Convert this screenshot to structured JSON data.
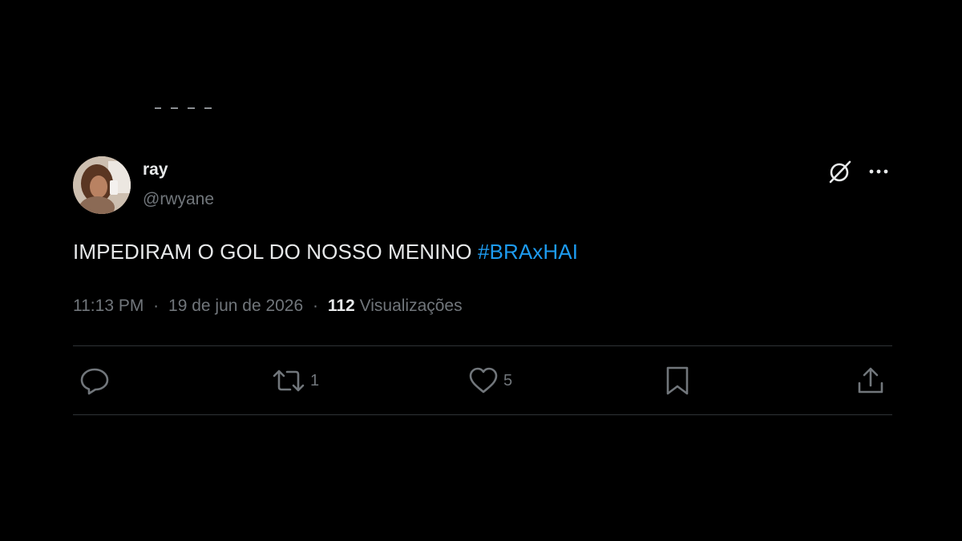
{
  "tweet": {
    "display_name": "ray",
    "handle": "@rwyane",
    "text_main": "IMPEDIRAM O GOL DO NOSSO MENINO ",
    "hashtag": "#BRAxHAI",
    "time": "11:13 PM",
    "separator": "·",
    "date": "19 de jun de 2026",
    "views_count": "112",
    "views_label": "Visualizações"
  },
  "actions": {
    "reply_count": "",
    "retweet_count": "1",
    "like_count": "5"
  },
  "icons": {
    "grok": "grok-icon",
    "more": "more-icon",
    "reply": "reply-icon",
    "retweet": "retweet-icon",
    "like": "heart-icon",
    "bookmark": "bookmark-icon",
    "share": "share-icon"
  },
  "colors": {
    "background": "#000000",
    "text": "#e7e9ea",
    "muted": "#71767b",
    "accent": "#1d9bf0",
    "divider": "#2f3336"
  }
}
